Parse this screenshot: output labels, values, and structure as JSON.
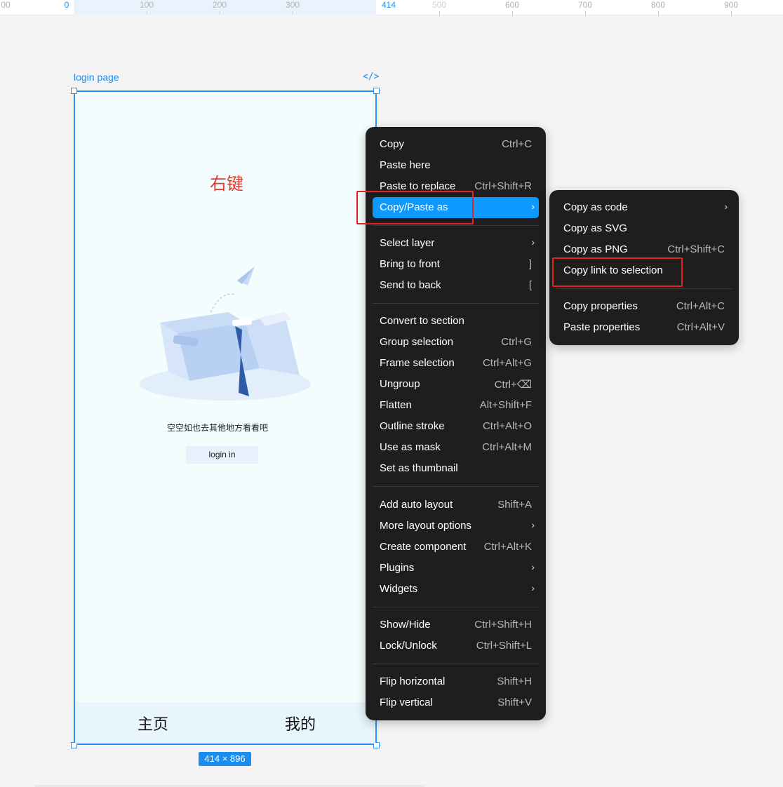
{
  "ruler": {
    "ticks": [
      "00",
      "0",
      "100",
      "200",
      "300",
      "414",
      "500",
      "600",
      "700",
      "800",
      "900"
    ]
  },
  "frame": {
    "name": "login page",
    "code_icon": "</>",
    "dimensions": "414 × 896",
    "annotation": "右键",
    "empty_text": "空空如也去其他地方看看吧",
    "login_button": "login in",
    "tabs": [
      "主页",
      "我的"
    ]
  },
  "context_menu": {
    "items": [
      {
        "label": "Copy",
        "shortcut": "Ctrl+C"
      },
      {
        "label": "Paste here",
        "shortcut": ""
      },
      {
        "label": "Paste to replace",
        "shortcut": "Ctrl+Shift+R"
      },
      {
        "label": "Copy/Paste as",
        "submenu": "›"
      },
      {
        "label": "Select layer",
        "submenu": "›"
      },
      {
        "label": "Bring to front",
        "shortcut": "]"
      },
      {
        "label": "Send to back",
        "shortcut": "["
      },
      {
        "label": "Convert to section",
        "shortcut": ""
      },
      {
        "label": "Group selection",
        "shortcut": "Ctrl+G"
      },
      {
        "label": "Frame selection",
        "shortcut": "Ctrl+Alt+G"
      },
      {
        "label": "Ungroup",
        "shortcut": "Ctrl+⌫"
      },
      {
        "label": "Flatten",
        "shortcut": "Alt+Shift+F"
      },
      {
        "label": "Outline stroke",
        "shortcut": "Ctrl+Alt+O"
      },
      {
        "label": "Use as mask",
        "shortcut": "Ctrl+Alt+M"
      },
      {
        "label": "Set as thumbnail",
        "shortcut": ""
      },
      {
        "label": "Add auto layout",
        "shortcut": "Shift+A"
      },
      {
        "label": "More layout options",
        "submenu": "›"
      },
      {
        "label": "Create component",
        "shortcut": "Ctrl+Alt+K"
      },
      {
        "label": "Plugins",
        "submenu": "›"
      },
      {
        "label": "Widgets",
        "submenu": "›"
      },
      {
        "label": "Show/Hide",
        "shortcut": "Ctrl+Shift+H"
      },
      {
        "label": "Lock/Unlock",
        "shortcut": "Ctrl+Shift+L"
      },
      {
        "label": "Flip horizontal",
        "shortcut": "Shift+H"
      },
      {
        "label": "Flip vertical",
        "shortcut": "Shift+V"
      }
    ]
  },
  "submenu": {
    "items": [
      {
        "label": "Copy as code",
        "submenu": "›"
      },
      {
        "label": "Copy as SVG",
        "shortcut": ""
      },
      {
        "label": "Copy as PNG",
        "shortcut": "Ctrl+Shift+C"
      },
      {
        "label": "Copy link to selection",
        "shortcut": ""
      },
      {
        "label": "Copy properties",
        "shortcut": "Ctrl+Alt+C"
      },
      {
        "label": "Paste properties",
        "shortcut": "Ctrl+Alt+V"
      }
    ]
  },
  "colors": {
    "accent": "#0d99ff",
    "selection": "#2b93f0",
    "highlight_box": "#e32222",
    "menu_bg": "#1e1e1e"
  }
}
